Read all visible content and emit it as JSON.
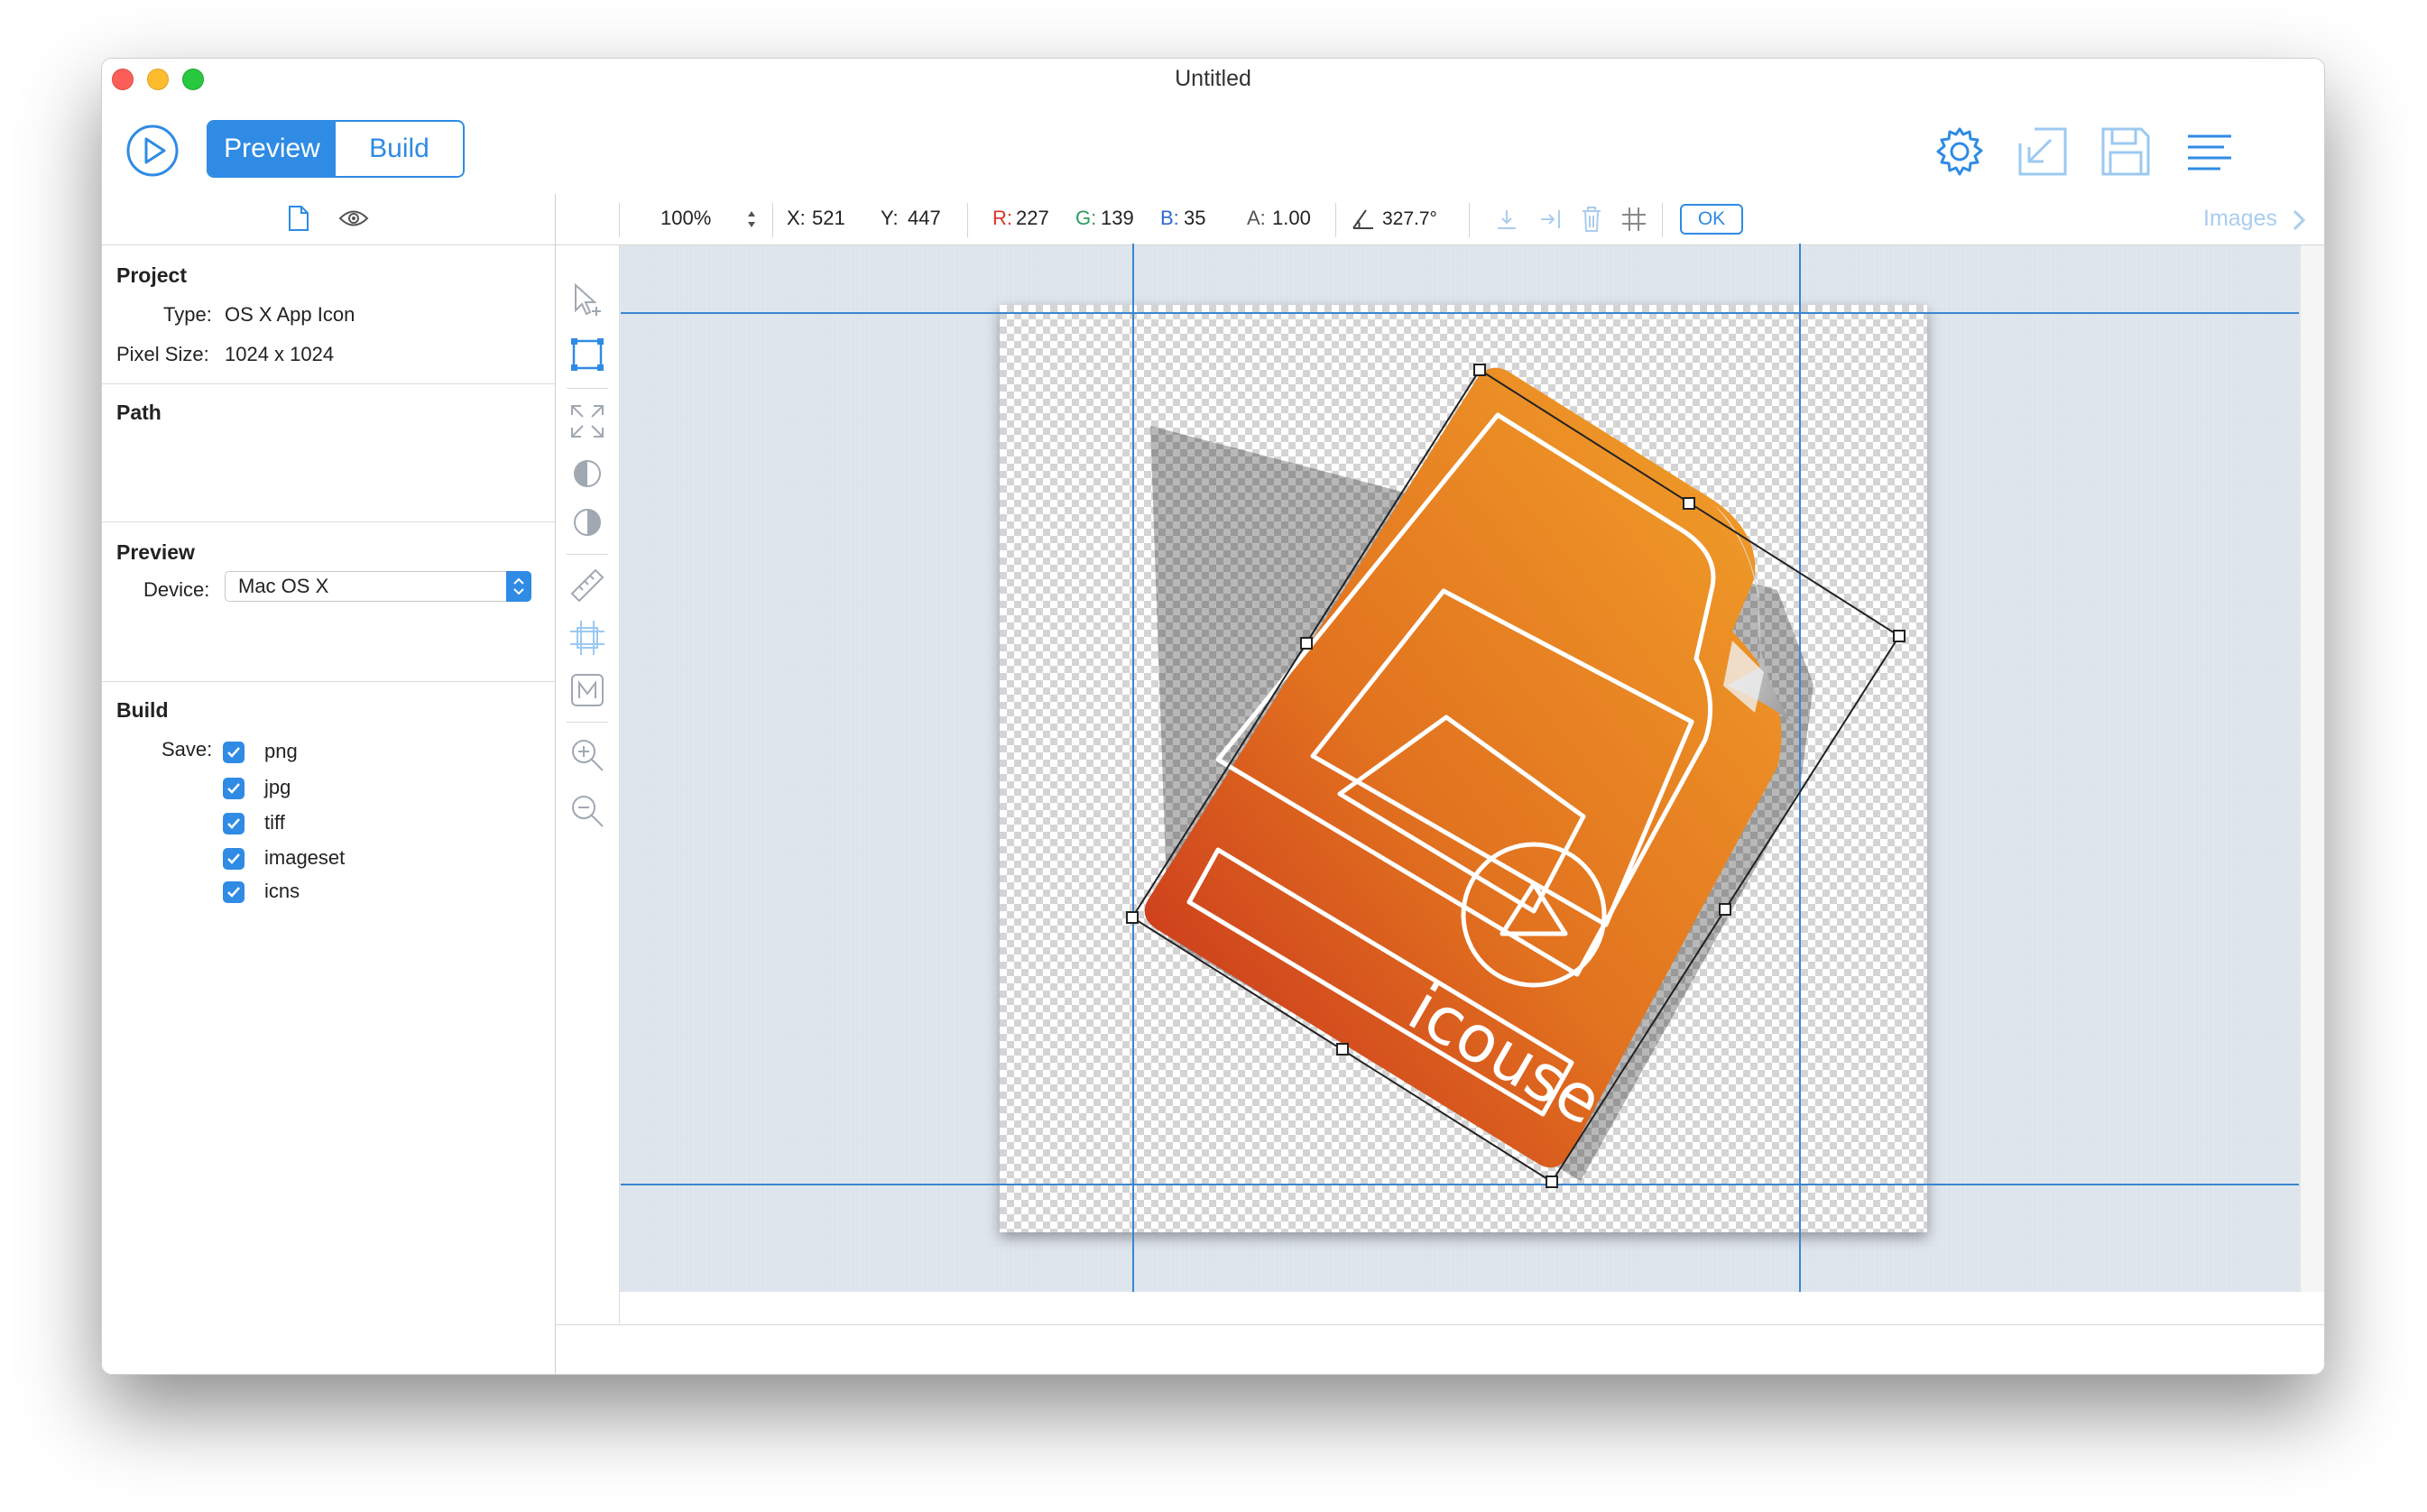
{
  "window": {
    "title": "Untitled"
  },
  "toolbar": {
    "play_icon": "play-circle-icon",
    "preview_label": "Preview",
    "build_label": "Build",
    "right_icons": [
      "gear-icon",
      "import-icon",
      "save-icon",
      "menu-lines-icon"
    ]
  },
  "sidebar": {
    "top_icons": [
      "document-icon",
      "eye-icon"
    ],
    "project": {
      "title": "Project",
      "type_label": "Type:",
      "type_value": "OS X App Icon",
      "size_label": "Pixel Size:",
      "size_value": "1024 x 1024"
    },
    "path": {
      "title": "Path"
    },
    "preview": {
      "title": "Preview",
      "device_label": "Device:",
      "device_value": "Mac OS X"
    },
    "build": {
      "title": "Build",
      "save_label": "Save:",
      "formats": [
        {
          "label": "png",
          "checked": true
        },
        {
          "label": "jpg",
          "checked": true
        },
        {
          "label": "tiff",
          "checked": true
        },
        {
          "label": "imageset",
          "checked": true
        },
        {
          "label": "icns",
          "checked": true
        }
      ]
    }
  },
  "infobar": {
    "zoom": "100%",
    "x_label": "X:",
    "x_value": "521",
    "y_label": "Y:",
    "y_value": "447",
    "r_label": "R:",
    "r_value": "227",
    "g_label": "G:",
    "g_value": "139",
    "b_label": "B:",
    "b_value": "35",
    "a_label": "A:",
    "a_value": "1.00",
    "angle": "327.7°",
    "ok_label": "OK",
    "images_label": "Images"
  },
  "canvas": {
    "icon_text": "icouse"
  },
  "colors": {
    "accent": "#2f8be4",
    "r_color": "#d6342c",
    "g_color": "#2f9a63",
    "b_color": "#2f6bd4"
  }
}
